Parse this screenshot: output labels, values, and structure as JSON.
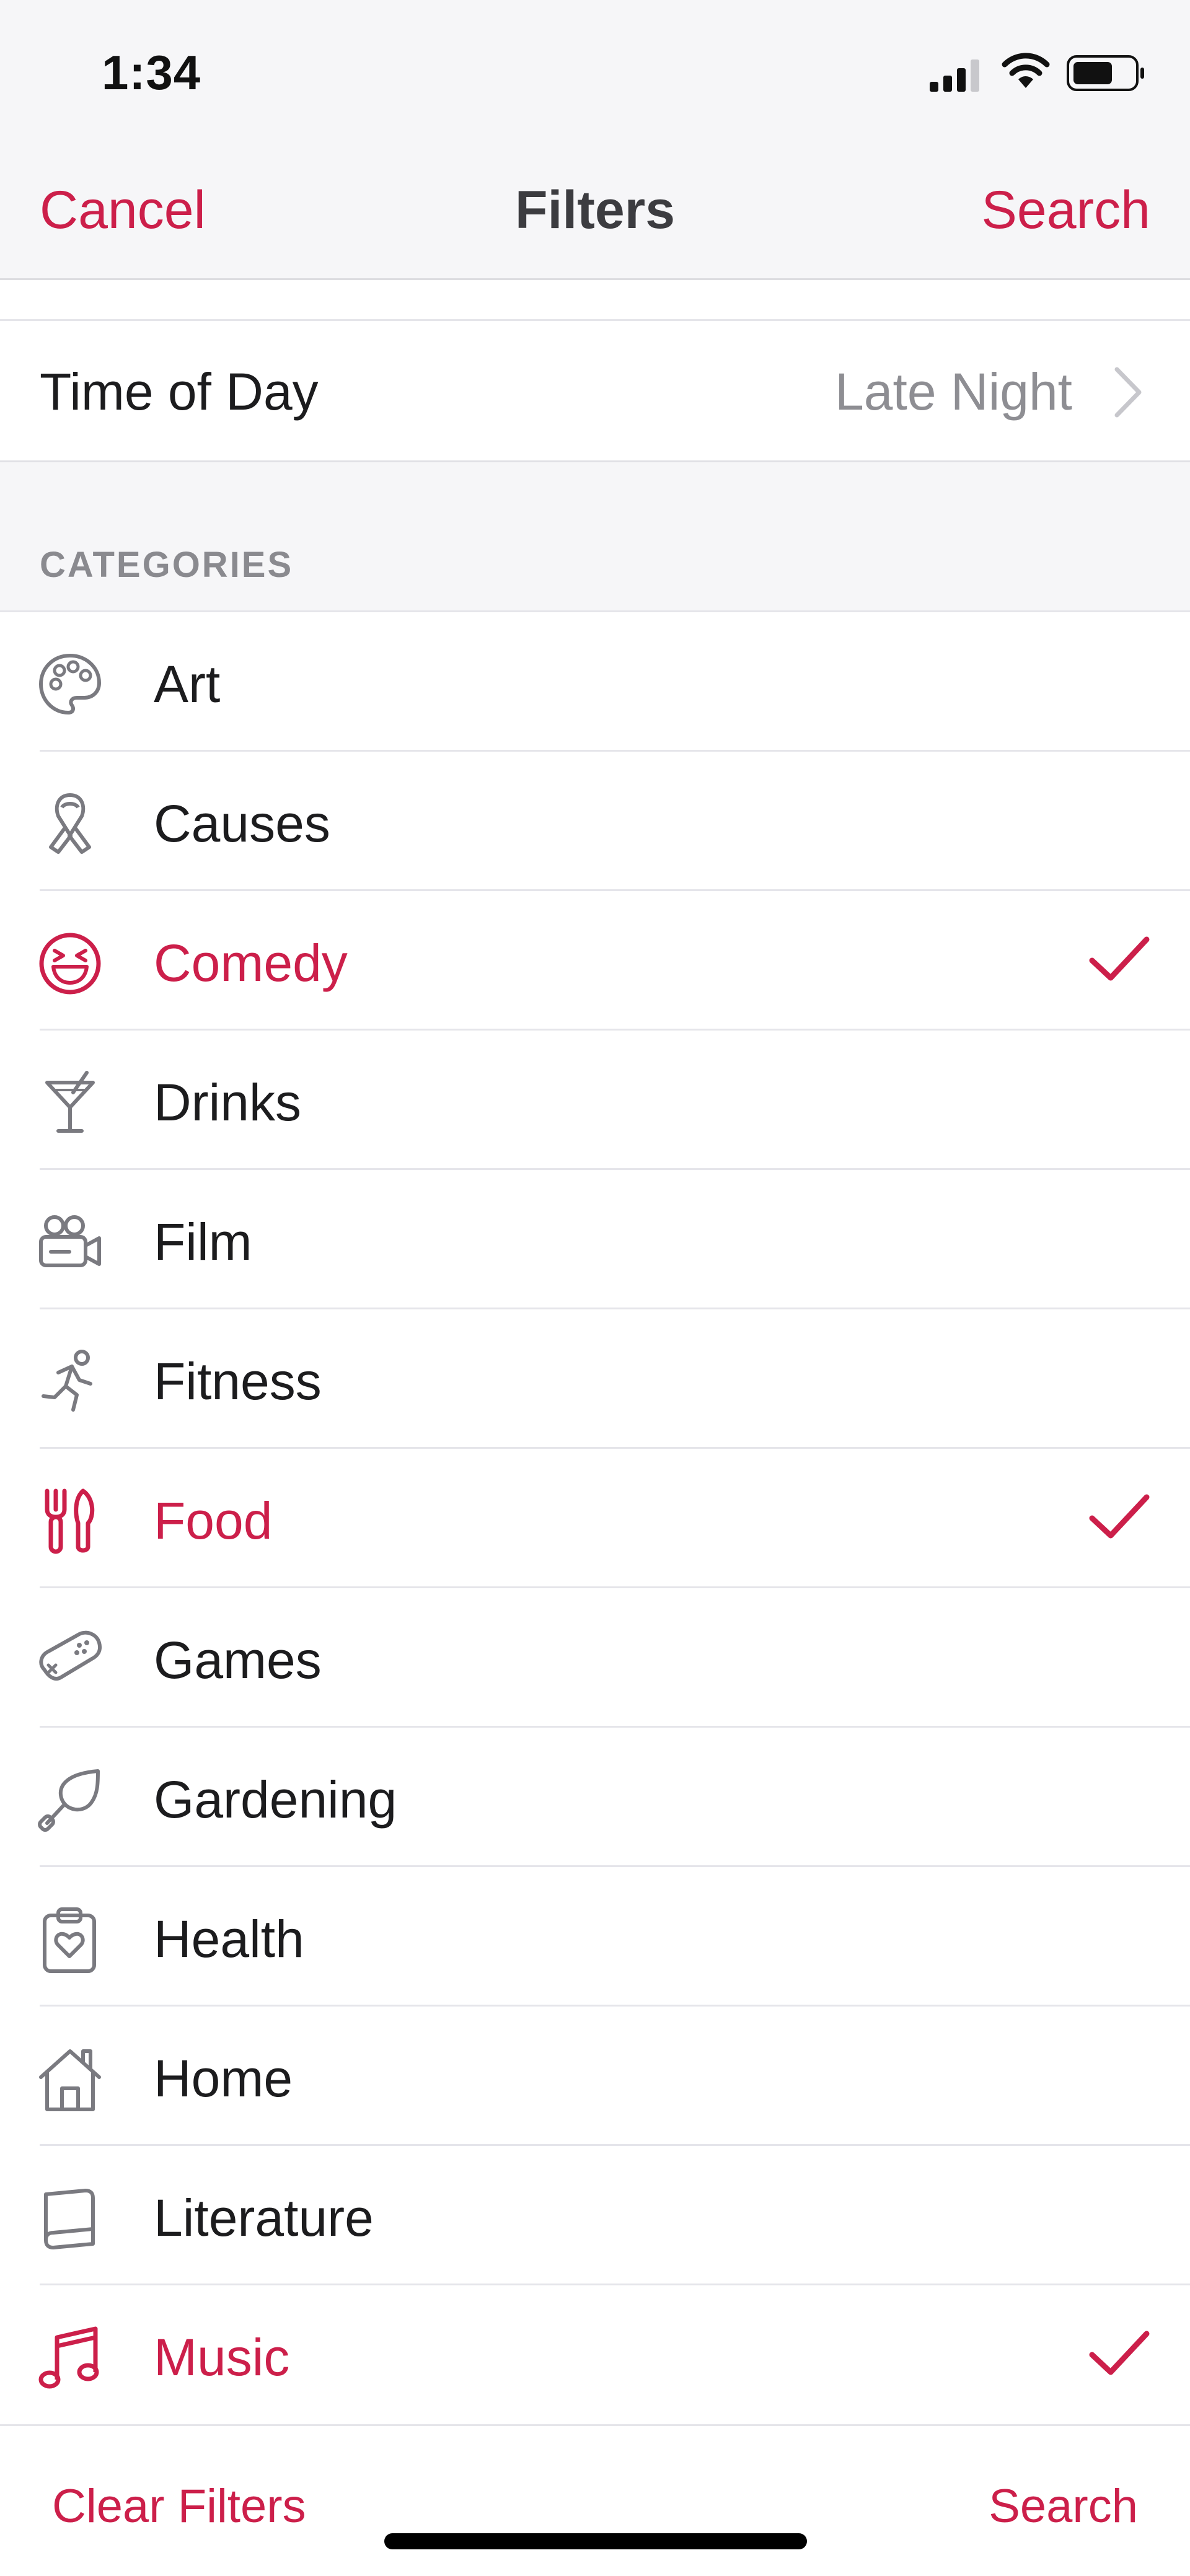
{
  "status_bar": {
    "time": "1:34"
  },
  "nav": {
    "cancel_label": "Cancel",
    "title": "Filters",
    "search_label": "Search"
  },
  "time_of_day": {
    "label": "Time of Day",
    "value": "Late Night"
  },
  "categories": {
    "header": "CATEGORIES",
    "items": [
      {
        "label": "Art",
        "icon": "palette-icon",
        "selected": false
      },
      {
        "label": "Causes",
        "icon": "ribbon-icon",
        "selected": false
      },
      {
        "label": "Comedy",
        "icon": "laughing-face-icon",
        "selected": true
      },
      {
        "label": "Drinks",
        "icon": "cocktail-icon",
        "selected": false
      },
      {
        "label": "Film",
        "icon": "movie-camera-icon",
        "selected": false
      },
      {
        "label": "Fitness",
        "icon": "running-person-icon",
        "selected": false
      },
      {
        "label": "Food",
        "icon": "fork-knife-icon",
        "selected": true
      },
      {
        "label": "Games",
        "icon": "game-controller-icon",
        "selected": false
      },
      {
        "label": "Gardening",
        "icon": "trowel-icon",
        "selected": false
      },
      {
        "label": "Health",
        "icon": "clipboard-heart-icon",
        "selected": false
      },
      {
        "label": "Home",
        "icon": "house-icon",
        "selected": false
      },
      {
        "label": "Literature",
        "icon": "book-icon",
        "selected": false
      },
      {
        "label": "Music",
        "icon": "music-note-icon",
        "selected": true
      }
    ]
  },
  "bottom_bar": {
    "clear_label": "Clear Filters",
    "search_label": "Search"
  },
  "colors": {
    "accent": "#cc1f4a",
    "icon_gray": "#7a7a80",
    "secondary_text": "#8e8e93"
  }
}
